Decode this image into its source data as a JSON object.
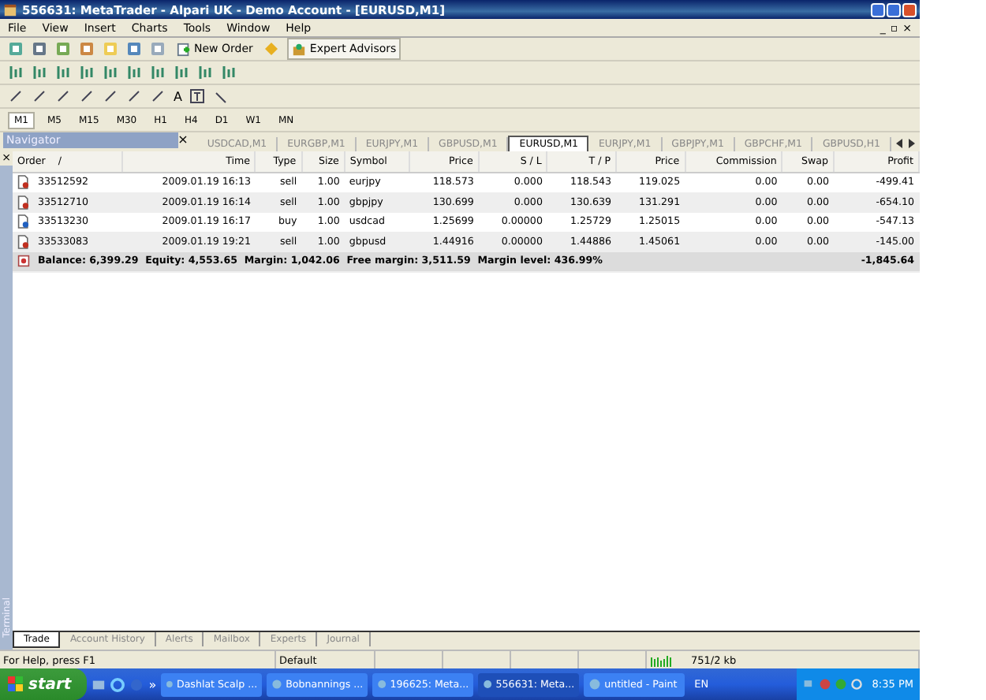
{
  "window": {
    "title": "556631: MetaTrader - Alpari UK - Demo Account - [EURUSD,M1]"
  },
  "menu": [
    "File",
    "View",
    "Insert",
    "Charts",
    "Tools",
    "Window",
    "Help"
  ],
  "mdi_buttons": [
    "_",
    "▫",
    "×"
  ],
  "toolbar": {
    "new_order": "New Order",
    "expert_advisors": "Expert Advisors",
    "text_tool": "A"
  },
  "timeframes": [
    {
      "label": "M1",
      "selected": true
    },
    {
      "label": "M5",
      "selected": false
    },
    {
      "label": "M15",
      "selected": false
    },
    {
      "label": "M30",
      "selected": false
    },
    {
      "label": "H1",
      "selected": false
    },
    {
      "label": "H4",
      "selected": false
    },
    {
      "label": "D1",
      "selected": false
    },
    {
      "label": "W1",
      "selected": false
    },
    {
      "label": "MN",
      "selected": false
    }
  ],
  "navigator": {
    "title": "Navigator",
    "close": "×"
  },
  "chart_tabs": [
    {
      "label": "USDCAD,M1",
      "selected": false
    },
    {
      "label": "EURGBP,M1",
      "selected": false
    },
    {
      "label": "EURJPY,M1",
      "selected": false
    },
    {
      "label": "GBPUSD,M1",
      "selected": false
    },
    {
      "label": "EURUSD,M1",
      "selected": true
    },
    {
      "label": "EURJPY,M1",
      "selected": false
    },
    {
      "label": "GBPJPY,M1",
      "selected": false
    },
    {
      "label": "GBPCHF,M1",
      "selected": false
    },
    {
      "label": "GBPUSD,H1",
      "selected": false
    }
  ],
  "terminal": {
    "side_label": "Terminal",
    "close": "×",
    "columns": [
      "Order",
      "Time",
      "Type",
      "Size",
      "Symbol",
      "Price",
      "S / L",
      "T / P",
      "Price",
      "Commission",
      "Swap",
      "Profit"
    ],
    "sort_mark": "/",
    "rows": [
      {
        "kind": "sell",
        "cells": [
          "33512592",
          "2009.01.19 16:13",
          "sell",
          "1.00",
          "eurjpy",
          "118.573",
          "0.000",
          "118.543",
          "119.025",
          "0.00",
          "0.00",
          "-499.41"
        ]
      },
      {
        "kind": "sell",
        "cells": [
          "33512710",
          "2009.01.19 16:14",
          "sell",
          "1.00",
          "gbpjpy",
          "130.699",
          "0.000",
          "130.639",
          "131.291",
          "0.00",
          "0.00",
          "-654.10"
        ]
      },
      {
        "kind": "buy",
        "cells": [
          "33513230",
          "2009.01.19 16:17",
          "buy",
          "1.00",
          "usdcad",
          "1.25699",
          "0.00000",
          "1.25729",
          "1.25015",
          "0.00",
          "0.00",
          "-547.13"
        ]
      },
      {
        "kind": "sell",
        "cells": [
          "33533083",
          "2009.01.19 19:21",
          "sell",
          "1.00",
          "gbpusd",
          "1.44916",
          "0.00000",
          "1.44886",
          "1.45061",
          "0.00",
          "0.00",
          "-145.00"
        ]
      }
    ],
    "summary": {
      "text": "Balance: 6,399.29  Equity: 4,553.65  Margin: 1,042.06  Free margin: 3,511.59  Margin level: 436.99%",
      "profit": "-1,845.64"
    },
    "tabs": [
      {
        "label": "Trade",
        "selected": true
      },
      {
        "label": "Account History",
        "selected": false
      },
      {
        "label": "Alerts",
        "selected": false
      },
      {
        "label": "Mailbox",
        "selected": false
      },
      {
        "label": "Experts",
        "selected": false
      },
      {
        "label": "Journal",
        "selected": false
      }
    ]
  },
  "status_bar": {
    "help": "For Help, press F1",
    "profile": "Default",
    "traffic": "751/2 kb"
  },
  "taskbar": {
    "start": "start",
    "more": "»",
    "tasks": [
      {
        "label": "Dashlat Scalp ...",
        "selected": false
      },
      {
        "label": "Bobnannings ...",
        "selected": false
      },
      {
        "label": "196625: Meta...",
        "selected": false
      },
      {
        "label": "556631: Meta...",
        "selected": true
      },
      {
        "label": "untitled - Paint",
        "selected": false
      }
    ],
    "language": "EN",
    "clock": "8:35 PM"
  }
}
